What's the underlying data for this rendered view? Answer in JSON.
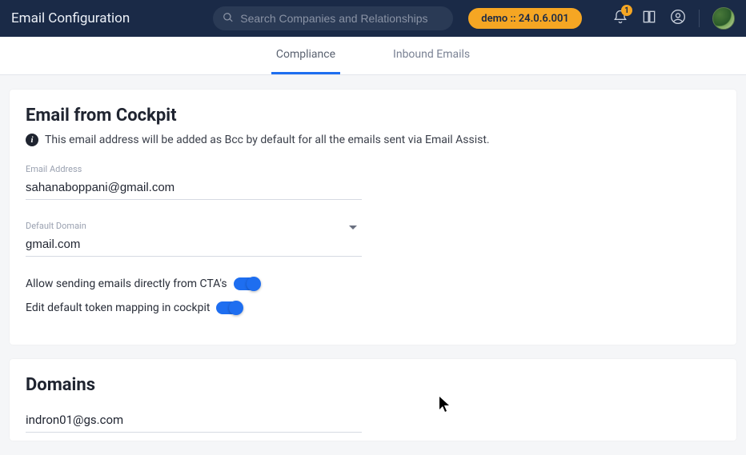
{
  "header": {
    "title": "Email Configuration",
    "search_placeholder": "Search Companies and Relationships",
    "env_badge": "demo :: 24.0.6.001",
    "notification_count": "1"
  },
  "tabs": [
    {
      "label": "Compliance",
      "active": true
    },
    {
      "label": "Inbound Emails",
      "active": false
    }
  ],
  "cockpit": {
    "title": "Email from Cockpit",
    "info_text": "This email address will be added as Bcc by default for all the emails sent via Email Assist.",
    "email_label": "Email Address",
    "email_value": "sahanaboppani@gmail.com",
    "domain_label": "Default Domain",
    "domain_value": "gmail.com",
    "toggle_cta_label": "Allow sending emails directly from CTA's",
    "toggle_cta_on": true,
    "toggle_token_label": "Edit default token mapping in cockpit",
    "toggle_token_on": true
  },
  "domains": {
    "title": "Domains",
    "items": [
      "indron01@gs.com"
    ]
  }
}
